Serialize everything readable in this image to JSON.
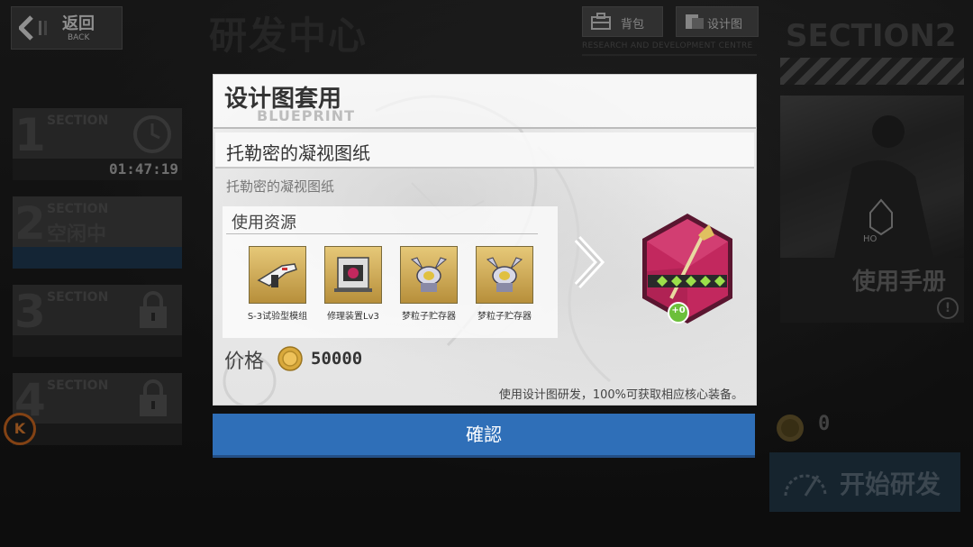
{
  "header": {
    "back_label": "返回",
    "back_sub": "BACK",
    "title": "研发中心",
    "tabs": [
      {
        "label": "背包",
        "icon": "backpack-icon"
      },
      {
        "label": "设计图",
        "icon": "blueprint-icon"
      }
    ],
    "caption": "RESEARCH AND DEVELOPMENT CENTRE"
  },
  "sections": [
    {
      "num": "1",
      "tag": "SECTION",
      "status": "",
      "timer": "01:47:19",
      "state": "timer"
    },
    {
      "num": "2",
      "tag": "SECTION",
      "status": "空闲中",
      "timer": "",
      "state": "idle"
    },
    {
      "num": "3",
      "tag": "SECTION",
      "status": "",
      "timer": "",
      "state": "locked"
    },
    {
      "num": "4",
      "tag": "SECTION",
      "status": "",
      "timer": "",
      "state": "locked"
    }
  ],
  "side_badge": "K",
  "right_panel": {
    "section_title": "SECTION2",
    "manual_label": "使用手册",
    "info": "!",
    "coin_value": "0",
    "start_label": "开始研发"
  },
  "modal": {
    "title": "设计图套用",
    "subtitle": "BLUEPRINT",
    "blueprint_name": "托勒密的凝视图纸",
    "blueprint_desc": "托勒密的凝视图纸",
    "resources_title": "使用资源",
    "resources": [
      {
        "label": "S-3试验型模组",
        "icon": "rifle-module-icon"
      },
      {
        "label": "修理装置Lv3",
        "icon": "repair-device-icon"
      },
      {
        "label": "梦粒子贮存器",
        "icon": "particle-storage-icon"
      },
      {
        "label": "梦粒子贮存器",
        "icon": "particle-storage-icon"
      }
    ],
    "equipment_badge": "+0",
    "equipment_icon": "staff-weapon-icon",
    "price_label": "价格",
    "price_value": "50000",
    "note": "使用设计图研发，100%可获取相应核心装备。"
  },
  "confirm_label": "確認",
  "colors": {
    "confirm_blue": "#2f6fb8",
    "equip_pink": "#c2285e",
    "gold": "#d9a93c",
    "accent_orange": "#c9661f"
  }
}
